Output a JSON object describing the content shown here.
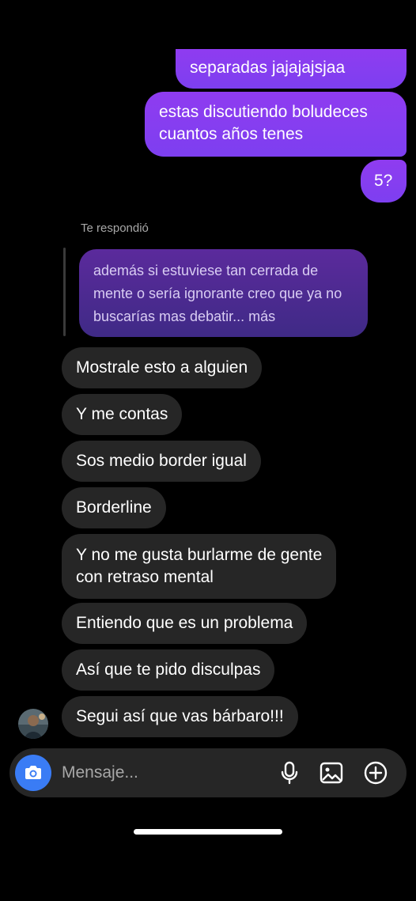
{
  "sent_messages": [
    "separadas jajajajsjaa",
    "estas discutiendo boludeces cuantos años tenes",
    "5?"
  ],
  "reply": {
    "label": "Te respondió",
    "quoted_text": "además si estuviese tan cerrada de mente o sería ignorante creo que ya no buscarías mas debatir... más"
  },
  "received_messages": [
    "Mostrale esto a alguien",
    "Y me contas",
    "Sos medio border igual",
    "Borderline",
    "Y no me gusta burlarme de gente",
    "con retraso mental",
    "Entiendo que es un problema",
    "Así que te pido disculpas",
    "Segui así que vas bárbaro!!!"
  ],
  "composer": {
    "placeholder": "Mensaje...",
    "camera_icon": "camera-icon",
    "mic_icon": "microphone-icon",
    "gallery_icon": "gallery-icon",
    "add_icon": "plus-circle-icon"
  },
  "colors": {
    "sent_bubble": "#8f3cf0",
    "received_bubble": "#262626",
    "camera_button": "#3a7cf5",
    "background": "#000000"
  }
}
